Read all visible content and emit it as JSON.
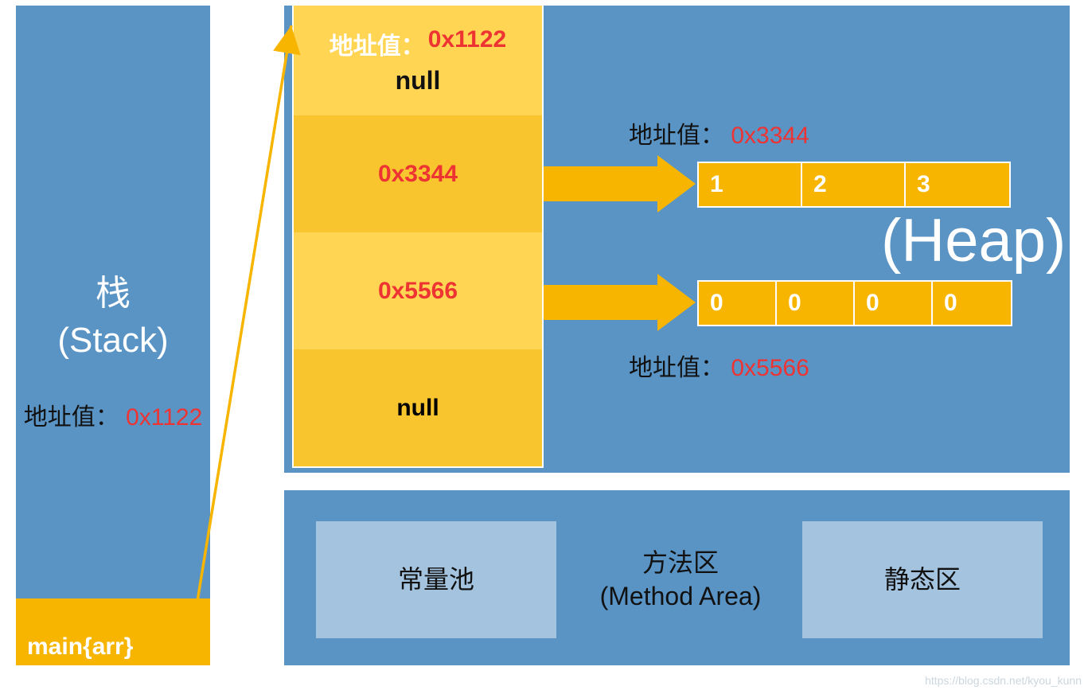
{
  "stack": {
    "title_cn": "栈",
    "title_en": "(Stack)",
    "addr_label": "地址值：",
    "addr_value": "0x1122",
    "main_label": "main{arr}"
  },
  "array_obj": {
    "header_label": "地址值：",
    "header_value": "0x1122",
    "slots": [
      "null",
      "0x3344",
      "0x5566",
      "null"
    ]
  },
  "heap": {
    "title": "(Heap)",
    "label1_lbl": "地址值：",
    "label1_val": "0x3344",
    "label2_lbl": "地址值：",
    "label2_val": "0x5566",
    "arr1": [
      "1",
      "2",
      "3"
    ],
    "arr2": [
      "0",
      "0",
      "0",
      "0"
    ]
  },
  "method_area": {
    "constant_pool": "常量池",
    "method_area_cn": "方法区",
    "method_area_en": "(Method Area)",
    "static_area": "静态区"
  },
  "watermark": "https://blog.csdn.net/kyou_kunn"
}
